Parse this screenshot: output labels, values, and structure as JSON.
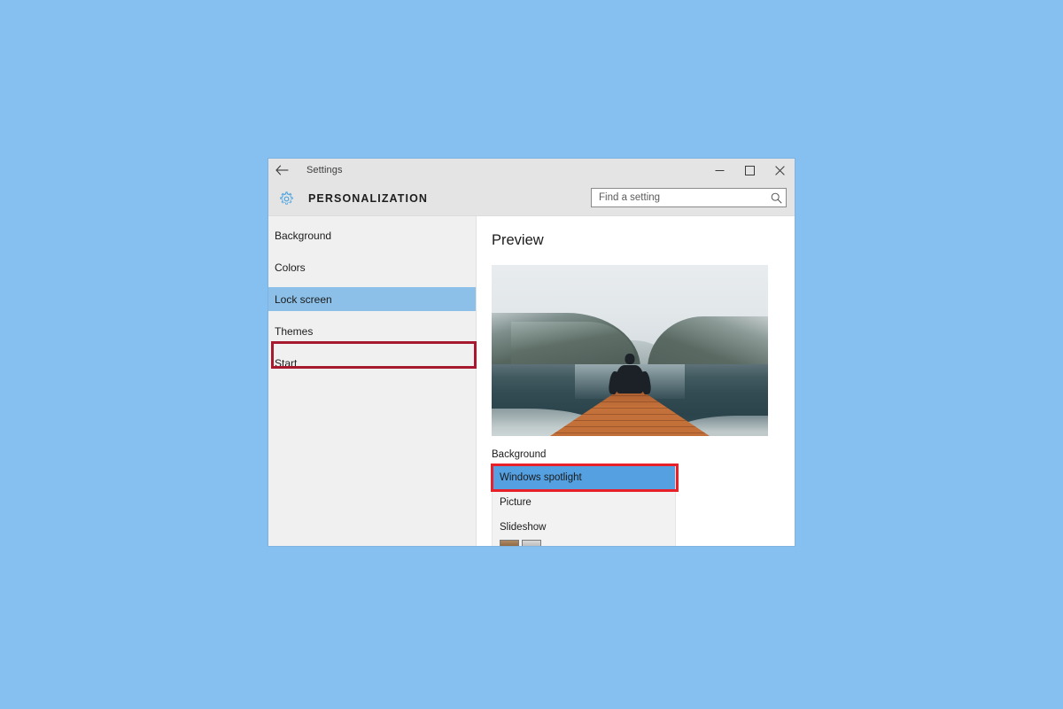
{
  "desktop": {
    "background_color": "#86c0f0"
  },
  "window": {
    "titlebar": {
      "back_label": "back-arrow",
      "title": "Settings",
      "minimize_glyph": "─",
      "maximize_glyph": "☐",
      "close_glyph": "✕"
    },
    "header": {
      "title": "PERSONALIZATION",
      "gear_icon": "gear-icon"
    },
    "search": {
      "placeholder": "Find a setting",
      "value": "",
      "icon": "search-icon"
    }
  },
  "sidebar": {
    "items": [
      {
        "label": "Background",
        "selected": false
      },
      {
        "label": "Colors",
        "selected": false
      },
      {
        "label": "Lock screen",
        "selected": true
      },
      {
        "label": "Themes",
        "selected": false
      },
      {
        "label": "Start",
        "selected": false
      }
    ],
    "highlight_color": "#a6192e",
    "selected_background": "#8cc0e8"
  },
  "content": {
    "heading": "Preview",
    "preview_image_alt": "Person sitting on a wooden dock facing a lake with snow-covered mountains",
    "background_section": {
      "label": "Background",
      "options": [
        {
          "label": "Windows spotlight",
          "selected": true
        },
        {
          "label": "Picture",
          "selected": false
        },
        {
          "label": "Slideshow",
          "selected": false
        }
      ],
      "selected_background": "#54a0e0",
      "highlight_color": "#e8202a"
    }
  }
}
